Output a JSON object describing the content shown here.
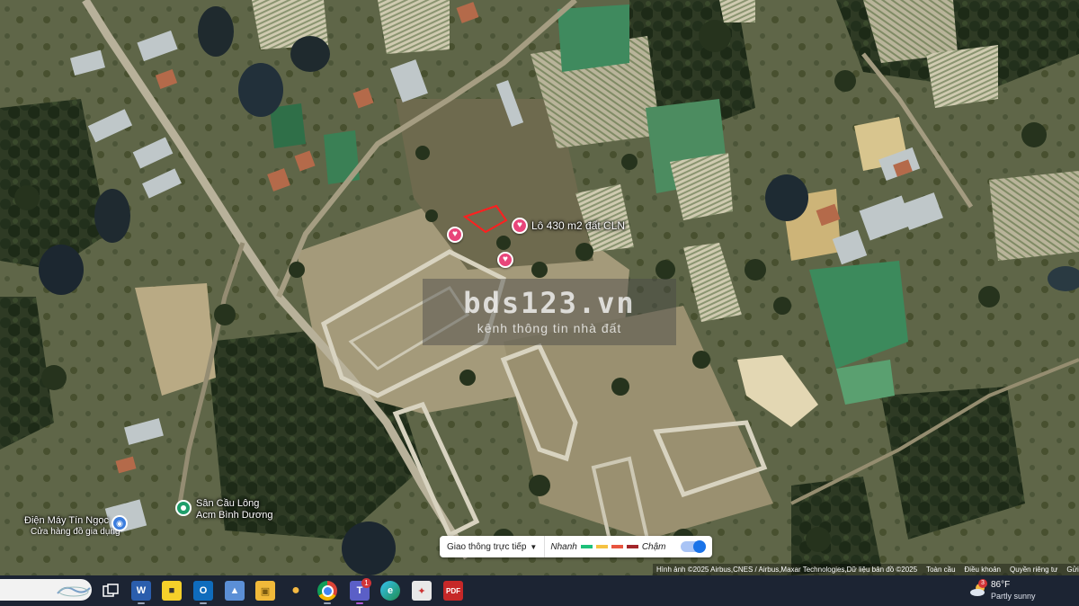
{
  "map": {
    "listing_label": "Lô 430 m2 đất CLN",
    "places": {
      "badminton_line1": "Sân Cầu Lông",
      "badminton_line2": "Acm Bình Dương",
      "store_name": "Điện Máy Tín Ngọc",
      "store_sub": "Cửa hàng đồ gia dụng"
    },
    "watermark": {
      "title": "bds123.vn",
      "subtitle": "kênh thông tin nhà đất"
    },
    "traffic": {
      "mode_label": "Giao thông trực tiếp",
      "fast_label": "Nhanh",
      "slow_label": "Chậm",
      "colors": [
        "#1ec07a",
        "#f5c242",
        "#e8553f",
        "#a3262a"
      ]
    },
    "attribution": {
      "imagery": "Hình ảnh ©2025 Airbus,CNES / Airbus,Maxar Technologies,Dữ liệu bản đồ ©2025",
      "terms": "Toàn cầu",
      "rules": "Điều khoản",
      "privacy": "Quyền riêng tư",
      "send": "Gửi"
    }
  },
  "taskbar": {
    "teams_badge": "1",
    "weather": {
      "badge": "3",
      "temp": "86°F",
      "desc": "Partly sunny"
    },
    "icons": [
      "search-box",
      "task-view",
      "word",
      "sticky-notes",
      "outlook",
      "photos",
      "file-explorer",
      "tips",
      "chrome",
      "teams",
      "edge",
      "snipping-tool",
      "pdf-reader"
    ]
  }
}
